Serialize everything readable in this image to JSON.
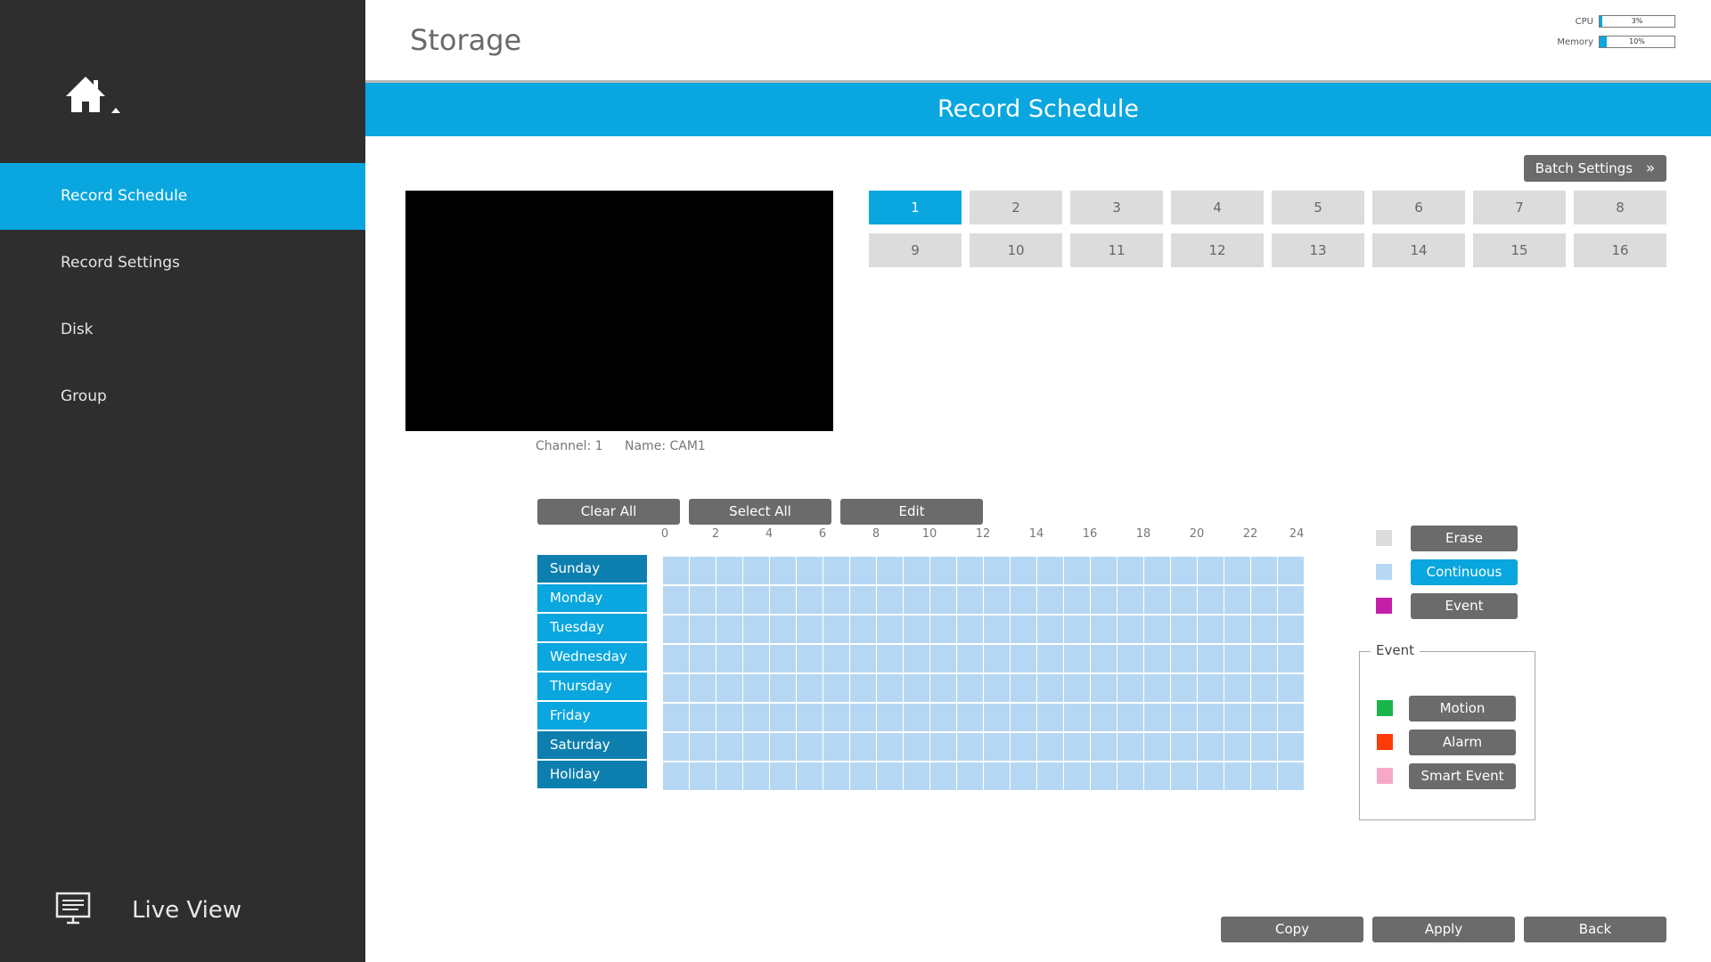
{
  "sidebar": {
    "home_icon": "home-icon",
    "items": [
      {
        "label": "Record Schedule",
        "active": true
      },
      {
        "label": "Record Settings",
        "active": false
      },
      {
        "label": "Disk",
        "active": false
      },
      {
        "label": "Group",
        "active": false
      }
    ],
    "live_view_label": "Live View",
    "live_view_icon": "monitor-icon"
  },
  "header": {
    "title": "Storage",
    "cpu_label": "CPU",
    "cpu_value": "3%",
    "cpu_fraction": 0.03,
    "memory_label": "Memory",
    "memory_value": "10%",
    "memory_fraction": 0.1
  },
  "section_title": "Record Schedule",
  "batch_settings_label": "Batch Settings",
  "channels": [
    "1",
    "2",
    "3",
    "4",
    "5",
    "6",
    "7",
    "8",
    "9",
    "10",
    "11",
    "12",
    "13",
    "14",
    "15",
    "16"
  ],
  "selected_channel": "1",
  "channel_info": {
    "channel": "Channel: 1",
    "name": "Name: CAM1"
  },
  "schedule": {
    "clear_all": "Clear All",
    "select_all": "Select All",
    "edit": "Edit",
    "hours": [
      "0",
      "2",
      "4",
      "6",
      "8",
      "10",
      "12",
      "14",
      "16",
      "18",
      "20",
      "22",
      "24"
    ],
    "days": [
      "Sunday",
      "Monday",
      "Tuesday",
      "Wednesday",
      "Thursday",
      "Friday",
      "Saturday",
      "Holiday"
    ],
    "fill_mode": "Continuous"
  },
  "legend": {
    "erase": "Erase",
    "continuous": "Continuous",
    "event": "Event",
    "erase_color": "#dcdcdc",
    "continuous_color": "#b6d7f3",
    "event_color": "#c41fa8",
    "event_group_title": "Event",
    "motion": "Motion",
    "alarm": "Alarm",
    "smart_event": "Smart Event",
    "motion_color": "#1ab54a",
    "alarm_color": "#ff3b0a",
    "smart_event_color": "#f7a8c8"
  },
  "footer": {
    "copy": "Copy",
    "apply": "Apply",
    "back": "Back"
  },
  "colors": {
    "accent": "#09a6df",
    "sidebar_bg": "#2e2e2e",
    "button_gray": "#6b6b6b"
  }
}
